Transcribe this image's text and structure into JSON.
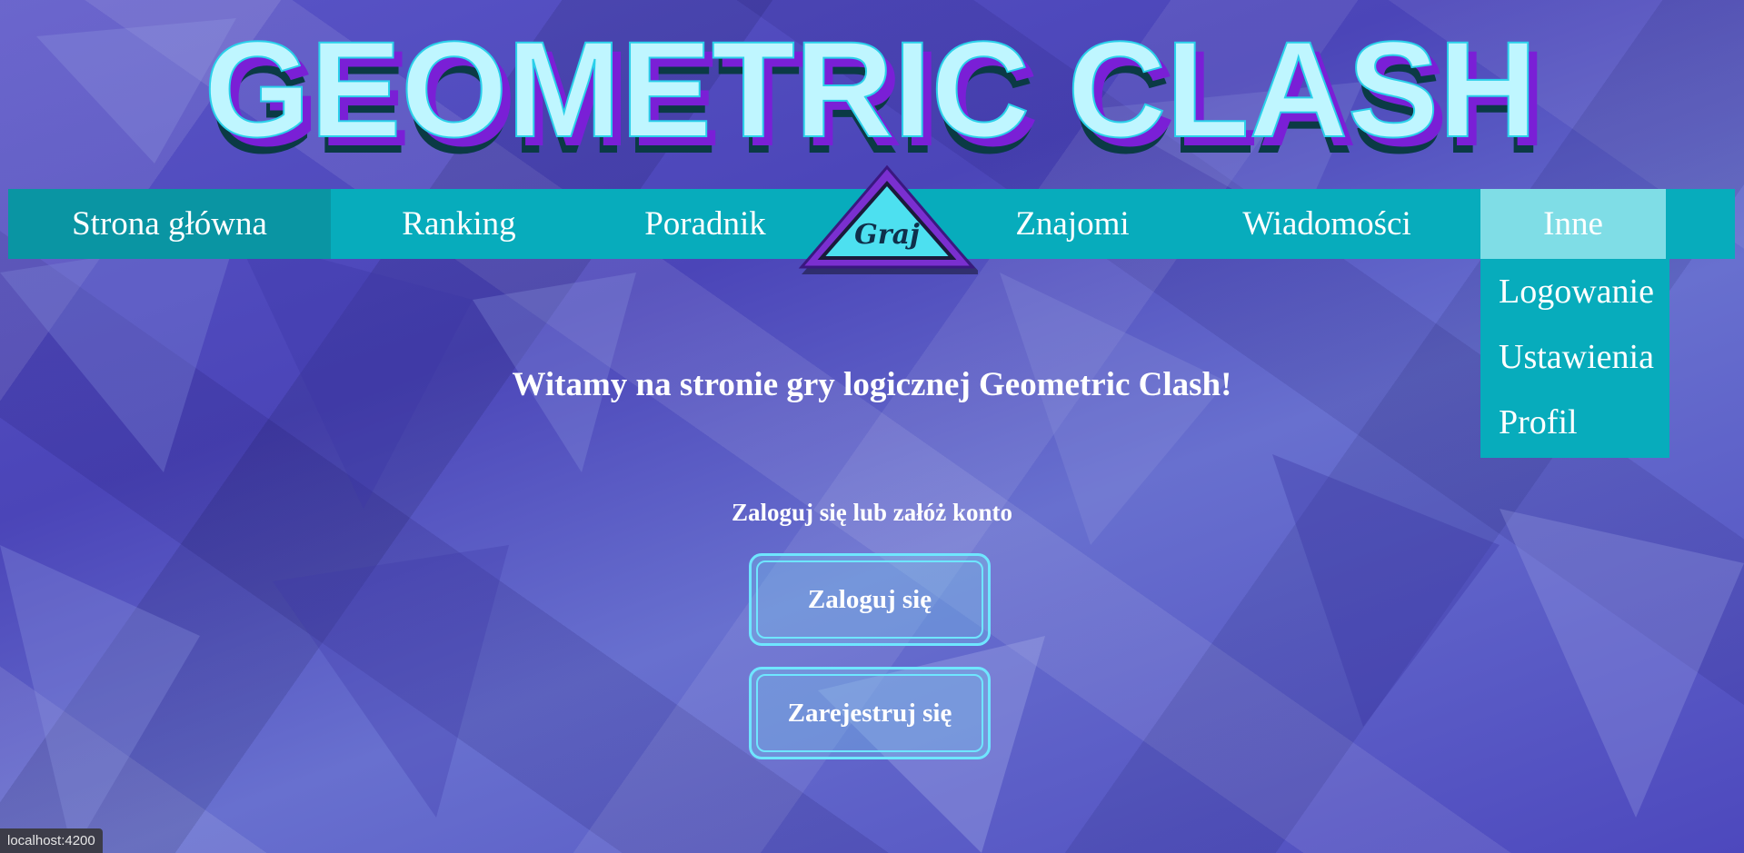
{
  "app": {
    "logo_text": "GEOMETRIC CLASH"
  },
  "nav": {
    "items": [
      {
        "label": "Strona główna"
      },
      {
        "label": "Ranking"
      },
      {
        "label": "Poradnik"
      },
      {
        "label": "Znajomi"
      },
      {
        "label": "Wiadomości"
      },
      {
        "label": "Inne"
      }
    ],
    "play_label": "Graj"
  },
  "dropdown": {
    "items": [
      {
        "label": "Logowanie"
      },
      {
        "label": "Ustawienia"
      },
      {
        "label": "Profil"
      }
    ]
  },
  "main": {
    "welcome": "Witamy na stronie gry logicznej Geometric Clash!",
    "subtitle": "Zaloguj się lub załóż konto",
    "login_button": "Zaloguj się",
    "register_button": "Zarejestruj się"
  },
  "status_bar": {
    "url": "localhost:4200"
  },
  "colors": {
    "nav_bg": "#07acbc",
    "nav_active": "#0a95a3",
    "nav_open": "#7fdde6",
    "accent_cyan": "#6fe6ff",
    "logo_fill": "#bff6ff",
    "logo_shadow": "#7a1fd6"
  }
}
